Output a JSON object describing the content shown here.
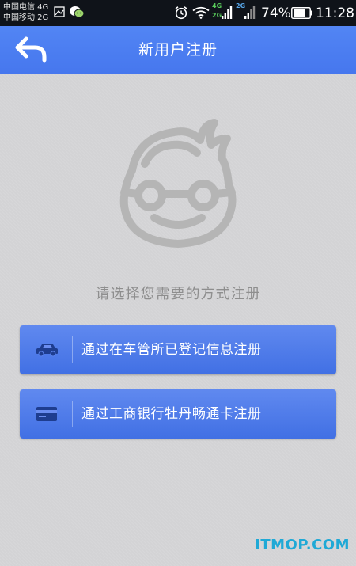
{
  "status_bar": {
    "carrier_1": "中国电信 4G",
    "carrier_2": "中国移动 2G",
    "network_1": "4G",
    "network_2": "2G",
    "network_3": "2G",
    "battery_percent": "74%",
    "time": "11:28",
    "icons": [
      "image-icon",
      "wechat-icon",
      "alarm-icon",
      "wifi-icon",
      "signal-icon",
      "battery-icon"
    ]
  },
  "nav": {
    "title": "新用户注册",
    "back_icon": "back-arrow-icon"
  },
  "main": {
    "avatar_icon": "boy-with-glasses-icon",
    "prompt": "请选择您需要的方式注册",
    "options": [
      {
        "label": "通过在车管所已登记信息注册",
        "icon": "car-icon"
      },
      {
        "label": "通过工商银行牡丹畅通卡注册",
        "icon": "card-icon"
      }
    ]
  },
  "watermark": "ITMOP.COM",
  "colors": {
    "status_bar_bg": "#0f1319",
    "nav_bg": "#4a7cf1",
    "page_bg": "#d3d3d5",
    "button_bg": "#4f7cea",
    "prompt_text": "#8e8e8e",
    "watermark": "#1fa9d6"
  }
}
